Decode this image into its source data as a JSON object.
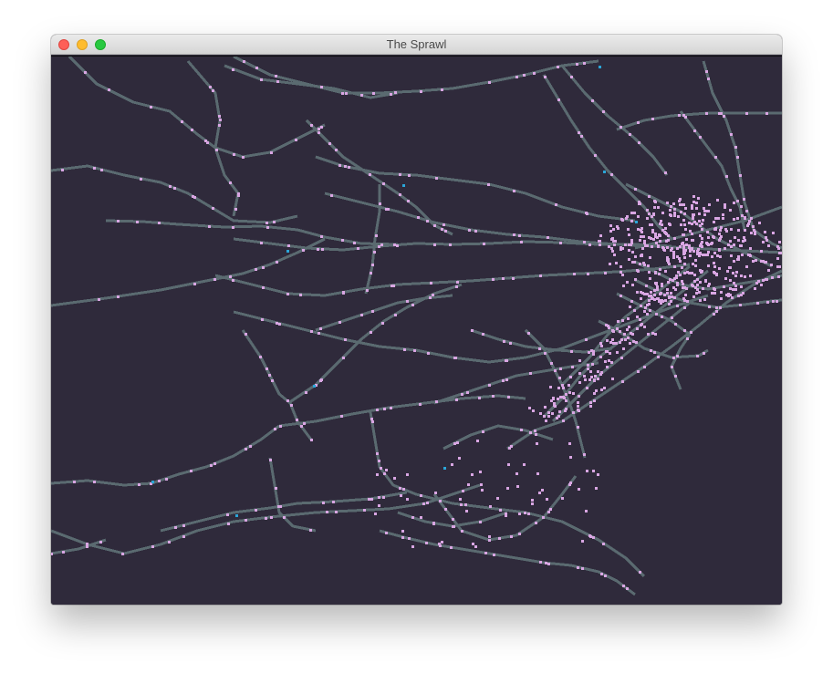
{
  "window": {
    "title": "The Sprawl",
    "controls": {
      "close": "close-icon",
      "minimize": "minimize-icon",
      "zoom": "zoom-icon"
    }
  },
  "map": {
    "colors": {
      "background": "#2f2a3b",
      "road": "#5a6a70",
      "node": "#d9a6e3",
      "highlight": "#2aa6d8"
    }
  }
}
